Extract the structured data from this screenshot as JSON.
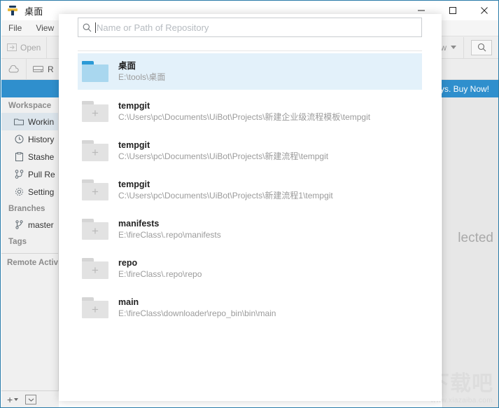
{
  "window": {
    "title": "桌面",
    "app_icon": "fork-icon",
    "minimize_label": "minimize-icon",
    "maximize_label": "maximize-icon",
    "close_label": "close-icon"
  },
  "menubar": {
    "items": [
      {
        "label": "File"
      },
      {
        "label": "View"
      }
    ]
  },
  "toolbar": {
    "open_label": "Open",
    "open_icon": "open-folder-icon",
    "dropdown_label": "ow",
    "dropdown_icon": "chevron-down-icon",
    "search_icon": "search-icon"
  },
  "toolbar2": {
    "cloud_icon": "cloud-icon",
    "repo_icon": "drive-icon",
    "repo_label": "R"
  },
  "banner": {
    "text": "ys. Buy Now!",
    "color": "#2f8fcd"
  },
  "sidebar": {
    "groups": [
      {
        "title": "Workspace",
        "items": [
          {
            "label": "Workin",
            "icon": "folder-icon",
            "selected": true
          },
          {
            "label": "History",
            "icon": "clock-icon",
            "selected": false
          },
          {
            "label": "Stashe",
            "icon": "clipboard-icon",
            "selected": false
          },
          {
            "label": "Pull Re",
            "icon": "pull-request-icon",
            "selected": false
          },
          {
            "label": "Setting",
            "icon": "gear-icon",
            "selected": false
          }
        ]
      },
      {
        "title": "Branches",
        "items": [
          {
            "label": "master",
            "icon": "branch-icon",
            "selected": false
          }
        ]
      },
      {
        "title": "Tags",
        "items": []
      }
    ],
    "footer_label": "Remote Activi",
    "bottom_bar": {
      "add_label": "+",
      "add_caret_icon": "chevron-down-icon",
      "box_icon": "inbox-icon"
    }
  },
  "main_panel": {
    "empty_text": "lected"
  },
  "watermark": {
    "text": "下载吧",
    "url": "www.xiazaiba.com"
  },
  "dialog": {
    "search": {
      "placeholder": "Name or Path of Repository",
      "value": "",
      "icon": "search-icon"
    },
    "repositories": [
      {
        "name": "桌面",
        "path": "E:\\tools\\桌面",
        "icon": "folder-blue-icon",
        "selected": true
      },
      {
        "name": "tempgit",
        "path": "C:\\Users\\pc\\Documents\\UiBot\\Projects\\新建企业级流程模板\\tempgit",
        "icon": "folder-add-icon",
        "selected": false
      },
      {
        "name": "tempgit",
        "path": "C:\\Users\\pc\\Documents\\UiBot\\Projects\\新建流程\\tempgit",
        "icon": "folder-add-icon",
        "selected": false
      },
      {
        "name": "tempgit",
        "path": "C:\\Users\\pc\\Documents\\UiBot\\Projects\\新建流程1\\tempgit",
        "icon": "folder-add-icon",
        "selected": false
      },
      {
        "name": "manifests",
        "path": "E:\\fireClass\\.repo\\manifests",
        "icon": "folder-add-icon",
        "selected": false
      },
      {
        "name": "repo",
        "path": "E:\\fireClass\\.repo\\repo",
        "icon": "folder-add-icon",
        "selected": false
      },
      {
        "name": "main",
        "path": "E:\\fireClass\\downloader\\repo_bin\\bin\\main",
        "icon": "folder-add-icon",
        "selected": false
      }
    ]
  }
}
